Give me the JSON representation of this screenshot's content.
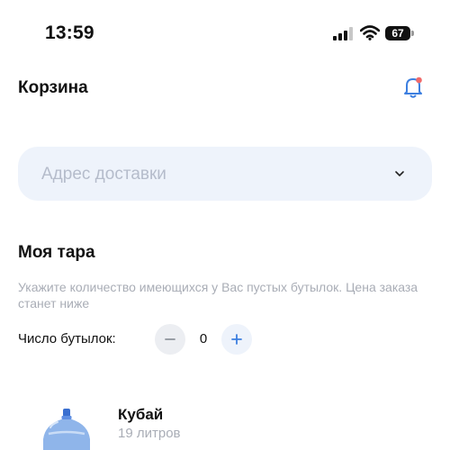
{
  "status_bar": {
    "time": "13:59",
    "battery": "67",
    "icons": [
      "signal-icon",
      "wifi-icon",
      "battery-icon"
    ]
  },
  "header": {
    "title": "Корзина",
    "notification_icon": "bell-icon",
    "notification_dot_color": "#f06a6a"
  },
  "address": {
    "placeholder": "Адрес доставки",
    "icon": "chevron-down-icon"
  },
  "tare": {
    "title": "Моя тара",
    "hint": "Укажите количество имеющихся у Вас пустых бутылок. Цена заказа станет ниже",
    "count_label": "Число бутылок:",
    "count": "0",
    "decrement_icon": "minus-icon",
    "increment_icon": "plus-icon"
  },
  "cart": {
    "items": [
      {
        "name": "Кубай",
        "volume": "19 литров",
        "image": "water-bottle-image"
      }
    ]
  },
  "colors": {
    "accent": "#3d7fe0",
    "field_bg": "#eef3fb",
    "muted_text": "#a9adb6"
  }
}
